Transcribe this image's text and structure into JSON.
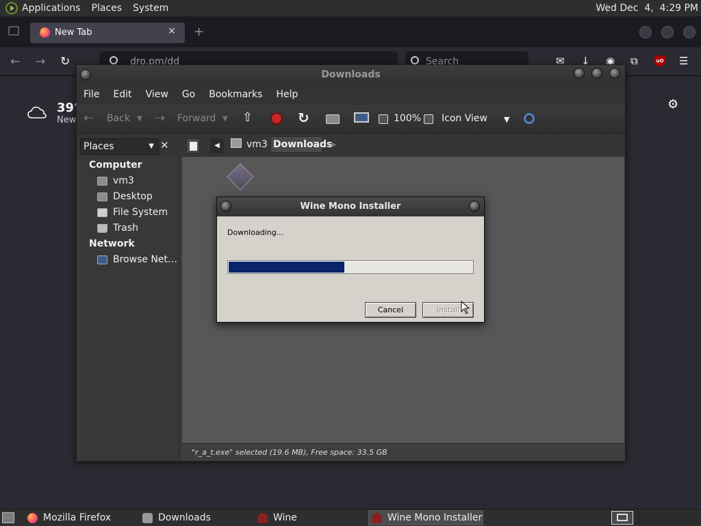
{
  "top_panel": {
    "menu": [
      "Applications",
      "Places",
      "System"
    ],
    "clock": "Wed Dec  4,  4:29 PM"
  },
  "firefox": {
    "tab_title": "New Tab",
    "url_text": "dro.pm/dd",
    "search_placeholder": "Search",
    "weather_temp": "39°",
    "weather_location": "New"
  },
  "downloads_window": {
    "title": "Downloads",
    "menu": [
      "File",
      "Edit",
      "View",
      "Go",
      "Bookmarks",
      "Help"
    ],
    "toolbar": {
      "back": "Back",
      "forward": "Forward",
      "zoom": "100%",
      "view_mode": "Icon View"
    },
    "places_combo": "Places",
    "breadcrumb": [
      "vm3",
      "Downloads"
    ],
    "sidebar": {
      "computer_heading": "Computer",
      "computer_items": [
        "vm3",
        "Desktop",
        "File System",
        "Trash"
      ],
      "network_heading": "Network",
      "network_items": [
        "Browse Net…"
      ]
    },
    "status": "\"r_a_t.exe\" selected (19.6 MB), Free space: 33.5 GB"
  },
  "wine_dialog": {
    "title": "Wine Mono Installer",
    "status": "Downloading...",
    "progress_fraction": 0.475,
    "progress_color": "#0a246a",
    "cancel_label": "Cancel",
    "install_label": "Install"
  },
  "taskbar": {
    "tasks": [
      "Mozilla Firefox",
      "Downloads",
      "Wine",
      "Wine Mono Installer"
    ]
  }
}
